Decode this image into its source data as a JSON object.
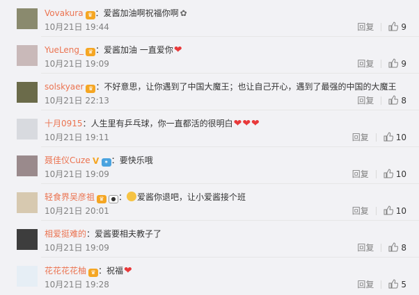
{
  "colors": {
    "username": "#eb7350",
    "meta": "#808080",
    "heart": "#e8393a",
    "divider": "#e6e6e6",
    "badge": "#f5a623"
  },
  "actions": {
    "reply_label": "回复"
  },
  "comments": [
    {
      "username": "Vovakura",
      "text": "爱酱加油啊祝福你啊",
      "time": "10月21日 19:44",
      "likes": "9",
      "avatar_icon": "avatar-icon"
    },
    {
      "username": "YueLeng_",
      "text": "爱酱加油 一直爱你",
      "time": "10月21日 19:09",
      "likes": "9",
      "avatar_icon": "avatar-icon"
    },
    {
      "username": "solskyaer",
      "text": "不好意思，让你遇到了中国大魔王；也让自己开心，遇到了最强的中国的大魔王",
      "time": "10月21日 22:13",
      "likes": "8",
      "avatar_icon": "avatar-icon"
    },
    {
      "username": "十月0915",
      "text": "人生里有乒乓球，你一直都活的很明白",
      "time": "10月21日 19:11",
      "likes": "10",
      "avatar_icon": "avatar-icon"
    },
    {
      "username": "聂佳仪Cuze",
      "text": "要快乐哦",
      "time": "10月21日 19:09",
      "likes": "10",
      "avatar_icon": "avatar-icon"
    },
    {
      "username": "轻食界吴彦祖",
      "text": "爱酱你退吧，让小爱酱接个班",
      "time": "10月21日 20:01",
      "likes": "10",
      "avatar_icon": "avatar-icon"
    },
    {
      "username": "相爱挺难的",
      "text": "爱酱要相夫教子了",
      "time": "10月21日 19:09",
      "likes": "8",
      "avatar_icon": "avatar-icon"
    },
    {
      "username": "花花花花柚",
      "text": "祝福",
      "time": "10月21日 19:28",
      "likes": "5",
      "avatar_icon": "avatar-icon"
    }
  ]
}
